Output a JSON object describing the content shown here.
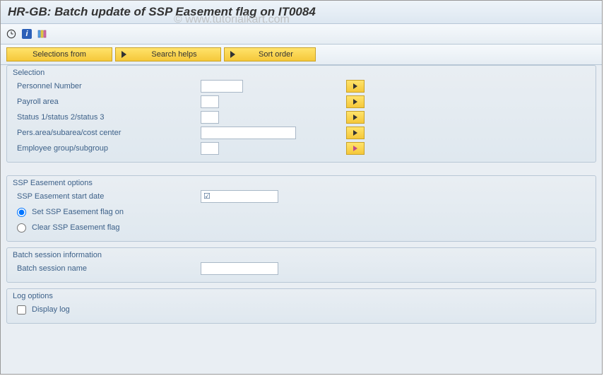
{
  "title": "HR-GB: Batch update of SSP Easement flag on IT0084",
  "watermark": "© www.tutorialkart.com",
  "app_toolbar": {
    "selections_from": "Selections from",
    "search_helps": "Search helps",
    "sort_order": "Sort order"
  },
  "groups": {
    "selection": {
      "title": "Selection",
      "personnel_number": {
        "label": "Personnel Number",
        "value": ""
      },
      "payroll_area": {
        "label": "Payroll area",
        "value": ""
      },
      "status": {
        "label": "Status 1/status 2/status 3",
        "value": ""
      },
      "pers_area": {
        "label": "Pers.area/subarea/cost center",
        "value": ""
      },
      "emp_group": {
        "label": "Employee group/subgroup",
        "value": ""
      }
    },
    "ssp": {
      "title": "SSP Easement options",
      "start_date": {
        "label": "SSP Easement start date",
        "value": ""
      },
      "set_on": "Set SSP Easement flag on",
      "clear": "Clear SSP Easement flag"
    },
    "batch": {
      "title": "Batch session information",
      "session_name": {
        "label": "Batch session name",
        "value": ""
      }
    },
    "log": {
      "title": "Log options",
      "display_log": "Display log"
    }
  }
}
